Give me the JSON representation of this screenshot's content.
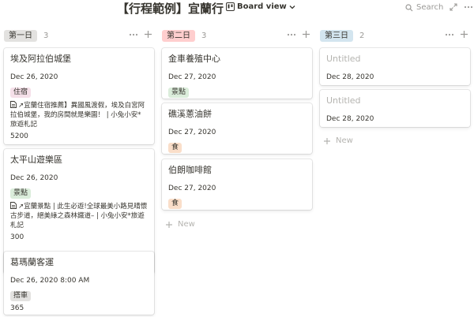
{
  "header": {
    "title": "【行程範例】宜蘭行",
    "view_label": "Board view",
    "search_label": "Search"
  },
  "columns": [
    {
      "label": "第一日",
      "count": "3",
      "tag_bg": "#e3e2e0",
      "cards": [
        {
          "title": "埃及阿拉伯城堡",
          "date": "Dec 26, 2020",
          "tag": "住宿",
          "link": "↗宜蘭住宿推薦】異國風渡假，埃及白宮阿拉伯城堡，我的房間就是樂園！ | 小兔小安*旅遊札記",
          "num": "5200"
        },
        {
          "title": "太平山遊樂區",
          "date": "Dec 26, 2020",
          "tag": "景點",
          "link": "↗宜蘭景點 | 此生必遊!全球最美小路見晴懷古步道，絕美綠之森林鐵道– | 小兔小安*旅遊札記",
          "num": "300"
        },
        {
          "title": "葛瑪蘭客運",
          "date": "Dec 26, 2020 8:00 AM",
          "tag": "搭車",
          "num": "365"
        }
      ]
    },
    {
      "label": "第二日",
      "count": "3",
      "tag_bg": "#ffcece",
      "cards": [
        {
          "title": "金車養殖中心",
          "date": "Dec 27, 2020",
          "tag": "景點"
        },
        {
          "title": "礁溪蔥油餅",
          "date": "Dec 27, 2020",
          "tag": "食"
        },
        {
          "title": "伯朗咖啡館",
          "date": "Dec 27, 2020",
          "tag": "食"
        }
      ],
      "new_label": "New"
    },
    {
      "label": "第三日",
      "count": "2",
      "tag_bg": "#d3e5ef",
      "cards": [
        {
          "title": "Untitled",
          "date": "Dec 28, 2020"
        },
        {
          "title": "Untitled",
          "date": "Dec 28, 2020"
        }
      ],
      "new_label": "New"
    }
  ],
  "colors": {
    "tag_lodging": "#f5e0e9",
    "tag_spot": "#dbeddb",
    "tag_food": "#fadec9",
    "tag_bus": "#e3e2e0",
    "text": "#37352f",
    "muted": "#9b9a97"
  }
}
